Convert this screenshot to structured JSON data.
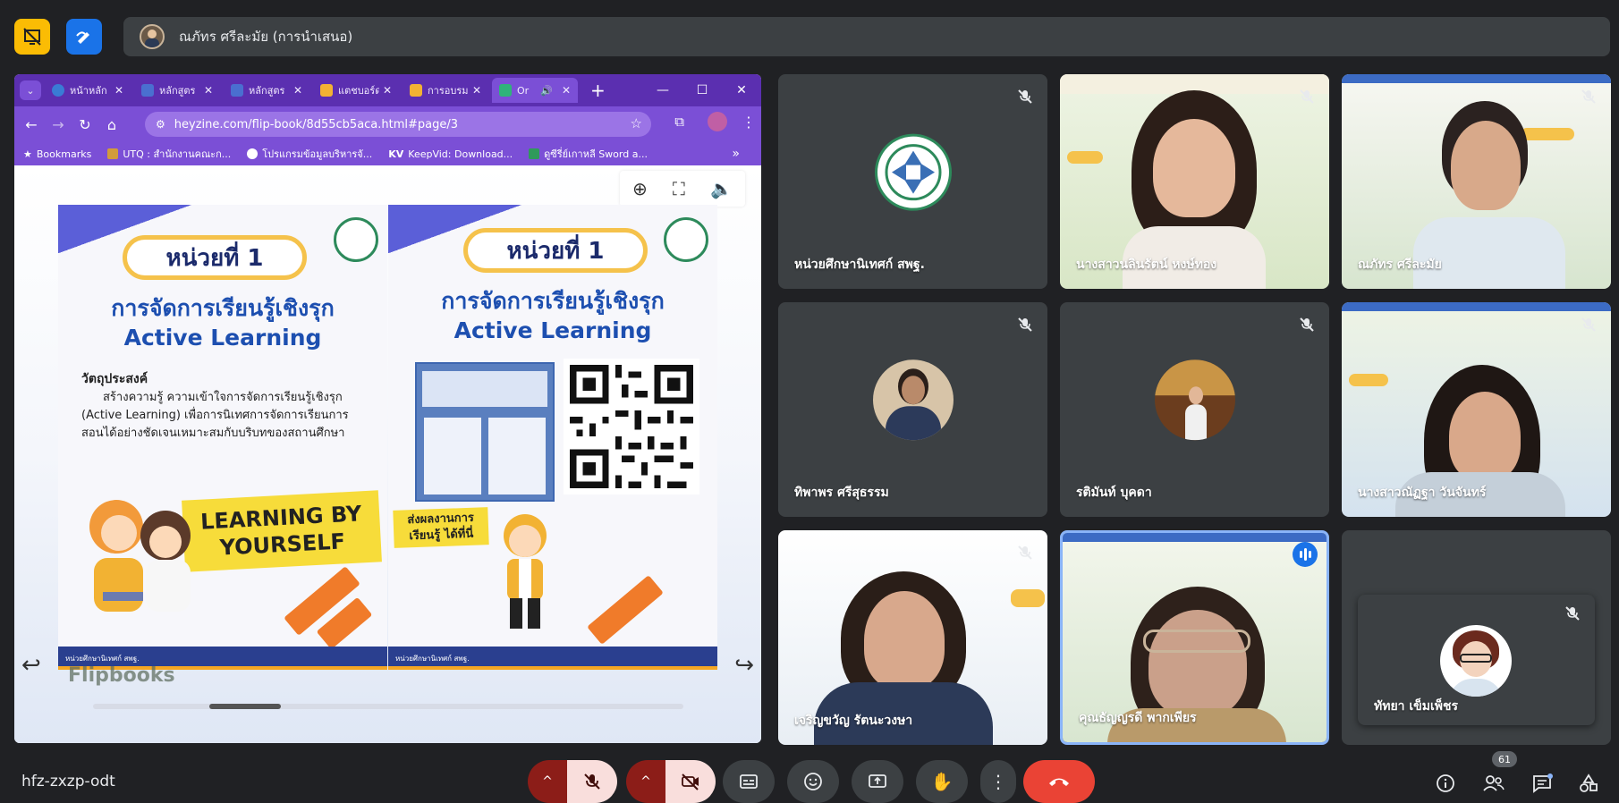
{
  "top": {
    "presenter_name": "ณภัทร ศรีละมัย (การนำเสนอ)",
    "yellow_btn_icon": "presentation-off-icon",
    "blue_btn_icon": "pen-annotate-icon"
  },
  "browser": {
    "tabs": [
      {
        "label": "หน้าหลัก",
        "icon": "c-icon"
      },
      {
        "label": "หลักสูตร",
        "icon": "shield-icon"
      },
      {
        "label": "หลักสูตร",
        "icon": "shield-icon"
      },
      {
        "label": "แตชบอร์ด",
        "icon": "star-icon"
      },
      {
        "label": "การอบรม",
        "icon": "star-icon"
      },
      {
        "label": "Or",
        "icon": "flipbook-icon",
        "active": true
      }
    ],
    "url": "heyzine.com/flip-book/8d55cb5aca.html#page/3",
    "bookmarks": [
      {
        "label": "Bookmarks"
      },
      {
        "label": "UTQ : สำนักงานคณะก..."
      },
      {
        "label": "โปรแกรมข้อมูลบริหารจั..."
      },
      {
        "label": "KeepVid: Download..."
      },
      {
        "label": "ดูซีรี่ย์เกาหลี Sword a..."
      }
    ],
    "chevron_more": "»"
  },
  "flipbook": {
    "left_page": {
      "unit": "หน่วยที่ 1",
      "title_th": "การจัดการเรียนรู้เชิงรุก",
      "title_en": "Active Learning",
      "objective_heading": "วัตถุประสงค์",
      "objective_body": "สร้างความรู้ ความเข้าใจการจัดการเรียนรู้เชิงรุก (Active Learning) เพื่อการนิเทศการจัดการเรียนการสอนได้อย่างชัดเจนเหมาะสมกับบริบทของสถานศึกษา",
      "banner_line1": "LEARNING BY",
      "banner_line2": "YOURSELF",
      "footer": "หน่วยศึกษานิเทศก์ สพฐ."
    },
    "right_page": {
      "unit": "หน่วยที่ 1",
      "title_th": "การจัดการเรียนรู้เชิงรุก",
      "title_en": "Active Learning",
      "send_label_1": "ส่งผลงานการ",
      "send_label_2": "เรียนรู้ ได้ที่นี่",
      "footer": "หน่วยศึกษานิเทศก์ สพฐ."
    },
    "brand": "Flipbooks"
  },
  "tiles": [
    {
      "name": "หน่วยศึกษานิเทศก์ สพฐ.",
      "muted": true,
      "kind": "avatar"
    },
    {
      "name": "นางสาวนลินรัตน์ หงษ์ทอง",
      "muted": true,
      "kind": "camera"
    },
    {
      "name": "ณภัทร ศรีละมัย",
      "muted": true,
      "kind": "camera"
    },
    {
      "name": "ทิพาพร ศรีสุธรรม",
      "muted": true,
      "kind": "avatar"
    },
    {
      "name": "รติมันท์ บุคดา",
      "muted": true,
      "kind": "avatar"
    },
    {
      "name": "นางสาวณัฏฐา วันจันทร์",
      "muted": true,
      "kind": "camera"
    },
    {
      "name": "เจริญขวัญ รัตนะวงษา",
      "muted": true,
      "kind": "camera"
    },
    {
      "name": "คุณธัญญรดี พากเพียร",
      "muted": false,
      "speaking": true,
      "kind": "camera"
    },
    {
      "name": "ทัทยา เข็มเพ็ชร",
      "muted": true,
      "kind": "avatar"
    }
  ],
  "bottom": {
    "meeting_code": "hfz-zxzp-odt",
    "participants_count": "61"
  },
  "colors": {
    "meet_bg": "#202124",
    "browser_purple": "#7b4fd6",
    "hangup_red": "#ea4335",
    "muted_red": "#f9dedc"
  }
}
